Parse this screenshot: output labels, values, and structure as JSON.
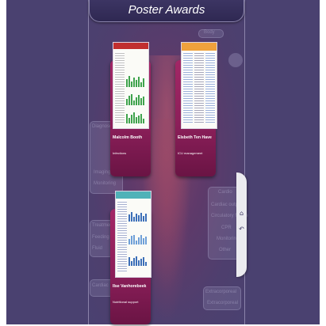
{
  "title": "Poster Awards",
  "ghost": {
    "top_label": "Body",
    "left_heading": "Diagnose",
    "left_items": [
      "Imaging",
      "Monitoring"
    ],
    "left_lower_heading": "Treatments",
    "left_lower_items": [
      "Feeding",
      "Fluid"
    ],
    "left_bottom": "Cardiac",
    "right_heading": "Cardio",
    "right_items": [
      "Cardiac output",
      "Circulatory failure",
      "CPR",
      "Monitoring",
      "Other"
    ],
    "right_bottom_heading": "Extracorporeal",
    "right_bottom_item": "Extracorporeal"
  },
  "cards": [
    {
      "author": "Malcolm Booth",
      "topic": "Infections"
    },
    {
      "author": "Elsbeth Ten Have",
      "topic": "ICU management"
    },
    {
      "author": "Ilse Vanhorebeek",
      "topic": "Nutritional support"
    }
  ],
  "side_tab": {
    "home_icon": "home-icon",
    "back_icon": "back-arrow-icon"
  },
  "colors": {
    "background": "#4a4170",
    "card": "#a32766",
    "title_bar": "#2f2852"
  }
}
